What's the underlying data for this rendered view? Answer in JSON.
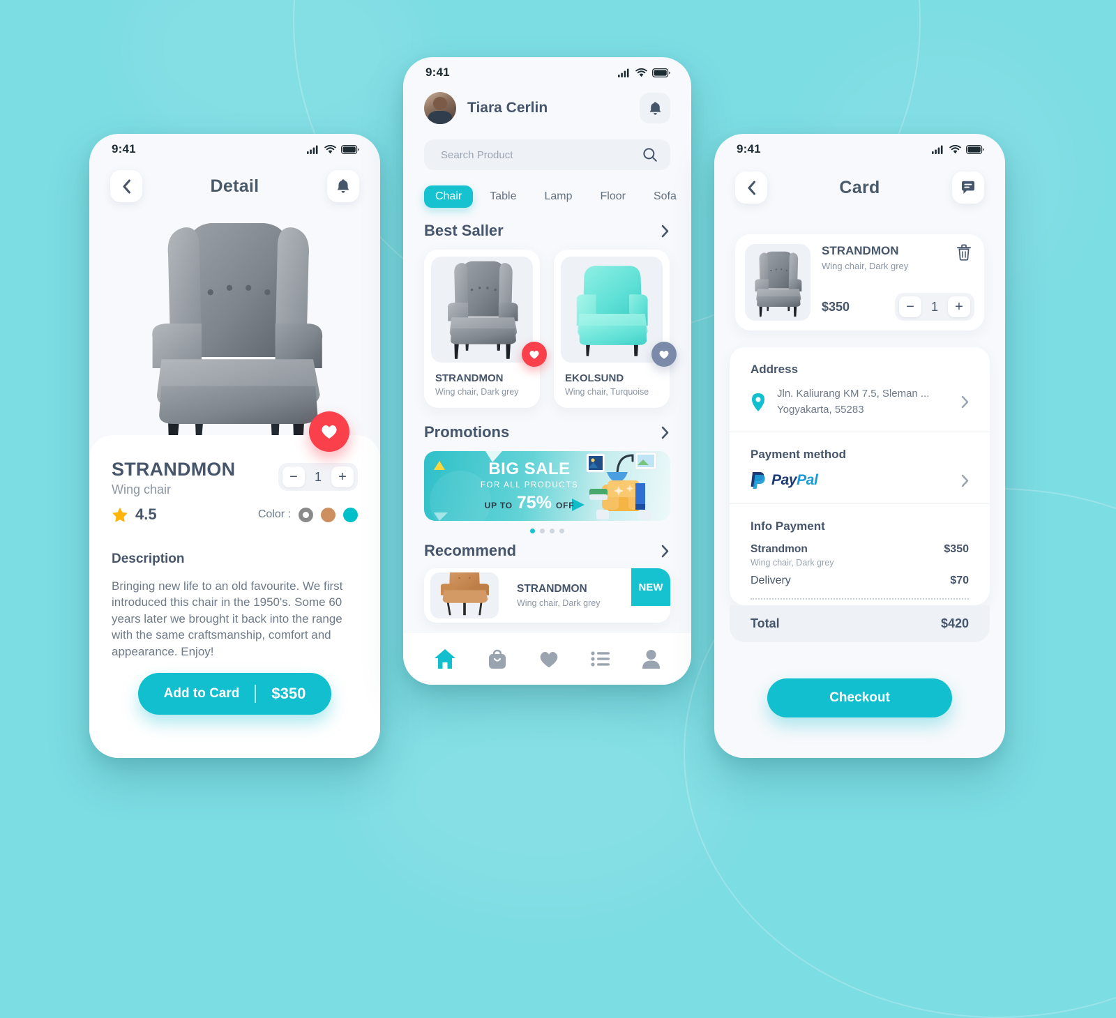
{
  "theme": {
    "background": "#7cdde3",
    "accent": "#11bfcf",
    "accent_alt": "#16c1d0",
    "text_dark": "#46556a",
    "text_muted": "#8b95a3",
    "fav_red": "#f9404b",
    "fav_grey": "#7b8aa8",
    "star_yellow": "#ffb40a",
    "screen_bg": "#f7f9fc"
  },
  "status_bar": {
    "time": "9:41"
  },
  "detail_screen": {
    "title": "Detail",
    "back_icon": "chevron-left-icon",
    "bell_icon": "bell-icon",
    "favorite_icon": "heart-icon",
    "product": {
      "name": "STRANDMON",
      "subtitle": "Wing chair",
      "rating": "4.5",
      "quantity": "1",
      "minus": "−",
      "plus": "+",
      "color_label": "Color :",
      "colors": [
        {
          "name": "Dark grey",
          "hex": "#8a8a8a",
          "selected": true
        },
        {
          "name": "Tan",
          "hex": "#cd8f5f",
          "selected": false
        },
        {
          "name": "Turquoise",
          "hex": "#00bfc9",
          "selected": false
        }
      ]
    },
    "description_heading": "Description",
    "description_text": "Bringing new life to an old favourite. We first introduced this chair in the 1950's. Some 60 years later we brought it back into the range with the same craftsmanship, comfort and appearance. Enjoy!",
    "cta": {
      "label": "Add to Card",
      "price": "$350"
    }
  },
  "home_screen": {
    "user_name": "Tiara Cerlin",
    "avatar_icon": "avatar",
    "bell_icon": "bell-icon",
    "search": {
      "placeholder": "Search Product",
      "value": "",
      "icon": "search-icon"
    },
    "categories": [
      {
        "label": "Chair",
        "active": true
      },
      {
        "label": "Table",
        "active": false
      },
      {
        "label": "Lamp",
        "active": false
      },
      {
        "label": "Floor",
        "active": false
      },
      {
        "label": "Sofa",
        "active": false
      }
    ],
    "best_seller": {
      "title": "Best Saller",
      "more_icon": "chevron-right-icon",
      "items": [
        {
          "name": "STRANDMON",
          "subtitle": "Wing chair, Dark grey",
          "fav_state": "active",
          "fav_icon": "heart-icon"
        },
        {
          "name": "EKOLSUND",
          "subtitle": "Wing chair, Turquoise",
          "fav_state": "inactive",
          "fav_icon": "heart-icon"
        }
      ]
    },
    "promotions": {
      "title": "Promotions",
      "more_icon": "chevron-right-icon",
      "banner": {
        "headline": "BIG SALE",
        "subline": "FOR ALL PRODUCTS",
        "upto": "UP TO",
        "percent": "75%",
        "off": "OFF"
      },
      "dots": [
        true,
        false,
        false,
        false
      ]
    },
    "recommend": {
      "title": "Recommend",
      "more_icon": "chevron-right-icon",
      "items": [
        {
          "name": "STRANDMON",
          "subtitle": "Wing chair, Dark grey",
          "badge": "NEW"
        }
      ]
    },
    "tabbar": [
      {
        "name": "home-icon",
        "active": true
      },
      {
        "name": "bag-icon",
        "active": false
      },
      {
        "name": "heart-icon",
        "active": false
      },
      {
        "name": "list-icon",
        "active": false
      },
      {
        "name": "profile-icon",
        "active": false
      }
    ]
  },
  "card_screen": {
    "title": "Card",
    "back_icon": "chevron-left-icon",
    "chat_icon": "chat-icon",
    "cart_item": {
      "name": "STRANDMON",
      "subtitle": "Wing chair, Dark grey",
      "price": "$350",
      "quantity": "1",
      "minus": "−",
      "plus": "+",
      "delete_icon": "trash-icon"
    },
    "address": {
      "heading": "Address",
      "pin_icon": "location-pin-icon",
      "line1": "Jln. Kaliurang KM 7.5, Sleman ...",
      "line2": "Yogyakarta,  55283",
      "chevron": "chevron-right-icon"
    },
    "payment_method": {
      "heading": "Payment method",
      "provider_a": "Pay",
      "provider_b": "Pal",
      "provider_icon": "paypal-icon",
      "chevron": "chevron-right-icon"
    },
    "info_payment": {
      "heading": "Info Payment",
      "lines": [
        {
          "name": "Strandmon",
          "subtitle": "Wing chair, Dark grey",
          "amount": "$350"
        },
        {
          "name": "Delivery",
          "subtitle": "",
          "amount": "$70"
        }
      ],
      "total_label": "Total",
      "total_amount": "$420"
    },
    "checkout_label": "Checkout"
  }
}
